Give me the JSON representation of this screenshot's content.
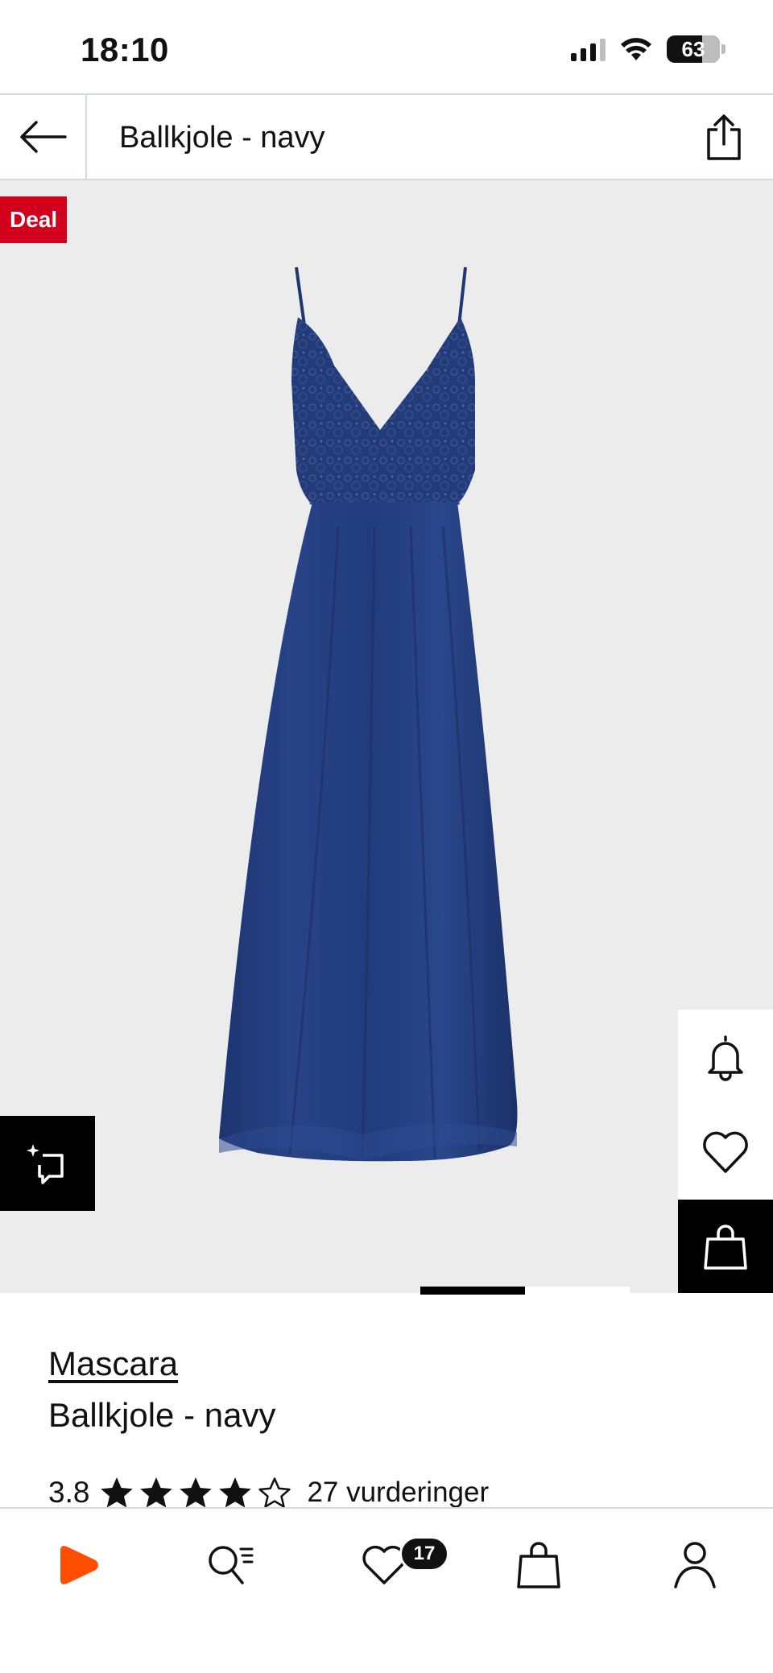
{
  "status_bar": {
    "time": "18:10",
    "battery": "63",
    "icons": [
      "signal-icon",
      "wifi-icon",
      "battery-icon"
    ]
  },
  "header": {
    "title": "Ballkjole - navy",
    "back_icon": "arrow-left-icon",
    "share_icon": "share-icon"
  },
  "gallery": {
    "badge": "Deal",
    "badge_color": "#d2001c",
    "image_subject": "navy-maxi-dress-icon",
    "actions": [
      "bell-icon",
      "heart-icon",
      "shopping-bag-icon"
    ],
    "compare_icon": "compare-icon"
  },
  "product": {
    "brand": "Mascara",
    "title": "Ballkjole - navy",
    "rating": "3.8",
    "rating_value": 3.8,
    "stars_filled": 4,
    "stars_total": 5,
    "rating_count": "27 vurderinger"
  },
  "tab_bar": {
    "items": [
      "home-logo-icon",
      "search-icon",
      "wishlist-icon",
      "bag-icon",
      "profile-icon"
    ],
    "wishlist_badge": "17",
    "brand_color": "#ff4e00"
  }
}
